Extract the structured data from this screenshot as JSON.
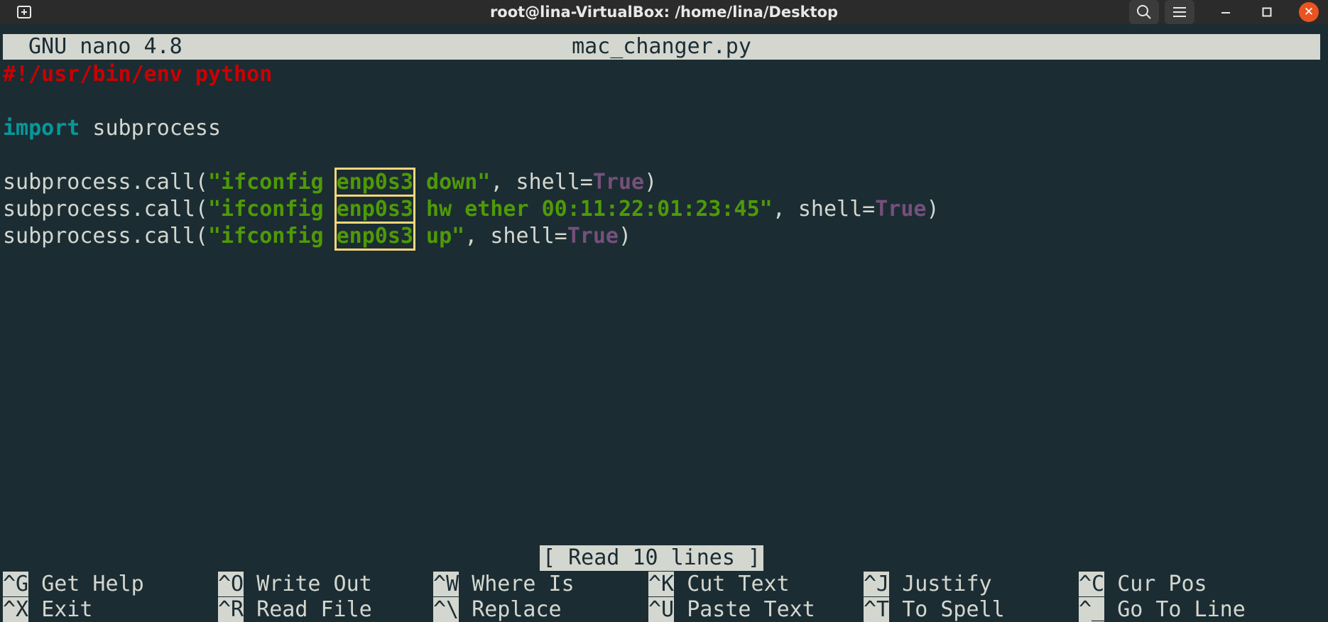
{
  "window": {
    "title": "root@lina-VirtualBox: /home/lina/Desktop",
    "buttons": {
      "new_tab": "new-tab-icon",
      "search": "search-icon",
      "menu": "hamburger-menu-icon",
      "minimize": "minimize-icon",
      "maximize": "maximize-icon",
      "close": "close-icon"
    }
  },
  "editor": {
    "version": "GNU nano 4.8",
    "filename": "mac_changer.py",
    "status": "[ Read 10 lines ]"
  },
  "code": {
    "shebang": "#!/usr/bin/env python",
    "import_kw": "import",
    "import_mod": " subprocess",
    "calls": [
      {
        "prefix": "subprocess.call(",
        "str_a": "\"ifconfig",
        "iface": "enp0s3",
        "str_b": "down\"",
        "mid": ", shell=",
        "bool": "True",
        "suffix": ")"
      },
      {
        "prefix": "subprocess.call(",
        "str_a": "\"ifconfig",
        "iface": "enp0s3",
        "str_b": "hw ether 00:11:22:01:23:45\"",
        "mid": ", shell=",
        "bool": "True",
        "suffix": ")"
      },
      {
        "prefix": "subprocess.call(",
        "str_a": "\"ifconfig",
        "iface": "enp0s3",
        "str_b": "up\"",
        "mid": ", shell=",
        "bool": "True",
        "suffix": ")"
      }
    ]
  },
  "shortcuts": [
    {
      "key": "^G",
      "label": "Get Help"
    },
    {
      "key": "^X",
      "label": "Exit"
    },
    {
      "key": "^O",
      "label": "Write Out"
    },
    {
      "key": "^R",
      "label": "Read File"
    },
    {
      "key": "^W",
      "label": "Where Is"
    },
    {
      "key": "^\\",
      "label": "Replace"
    },
    {
      "key": "^K",
      "label": "Cut Text"
    },
    {
      "key": "^U",
      "label": "Paste Text"
    },
    {
      "key": "^J",
      "label": "Justify"
    },
    {
      "key": "^T",
      "label": "To Spell"
    },
    {
      "key": "^C",
      "label": "Cur Pos"
    },
    {
      "key": "^_",
      "label": "Go To Line"
    }
  ],
  "colors": {
    "background": "#1c2c33",
    "highlight_box": "#f5d77a",
    "close_button": "#e95420"
  }
}
